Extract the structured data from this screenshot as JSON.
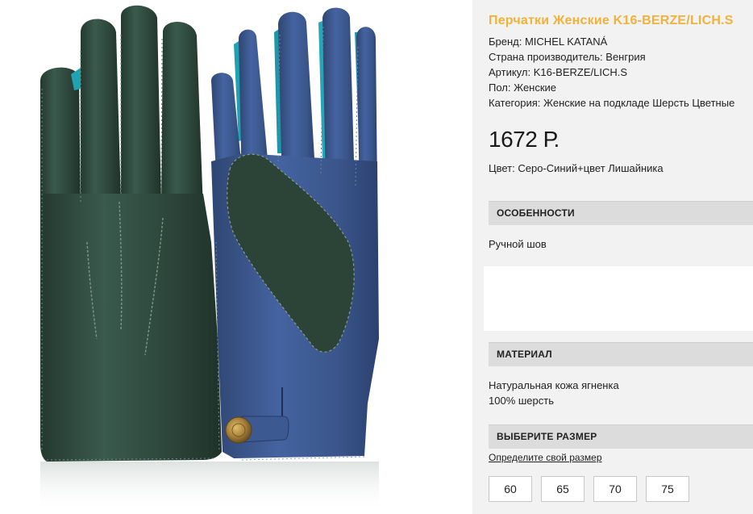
{
  "product": {
    "title": "Перчатки Женские K16-BERZE/LICH.S",
    "brand": "Бренд: MICHEL KATANÁ",
    "country": "Страна производитель: Венгрия",
    "article": "Артикул: K16-BERZE/LICH.S",
    "gender": "Пол: Женские",
    "category": "Категория: Женские на подкладе Шерсть Цветные",
    "price": "1672 Р.",
    "color": "Цвет: Серо-Синий+цвет Лишайника"
  },
  "features": {
    "header": "ОСОБЕННОСТИ",
    "text": "Ручной шов"
  },
  "material": {
    "header": "МАТЕРИАЛ",
    "lines": [
      "Натуральная кожа ягненка",
      "100% шерсть"
    ]
  },
  "sizes": {
    "header": "ВЫБЕРИТЕ РАЗМЕР",
    "link": "Определите свой размер",
    "options": [
      "60",
      "65",
      "70",
      "75"
    ]
  },
  "colors": {
    "title_accent": "#f0b23a",
    "glove_green": "#2f4a40",
    "glove_blue": "#3a5688",
    "lining_teal": "#1fa3b3",
    "snap_gold": "#b08a3e",
    "panel_bg": "#f2f2f2",
    "header_bg": "#dcdcdc"
  }
}
